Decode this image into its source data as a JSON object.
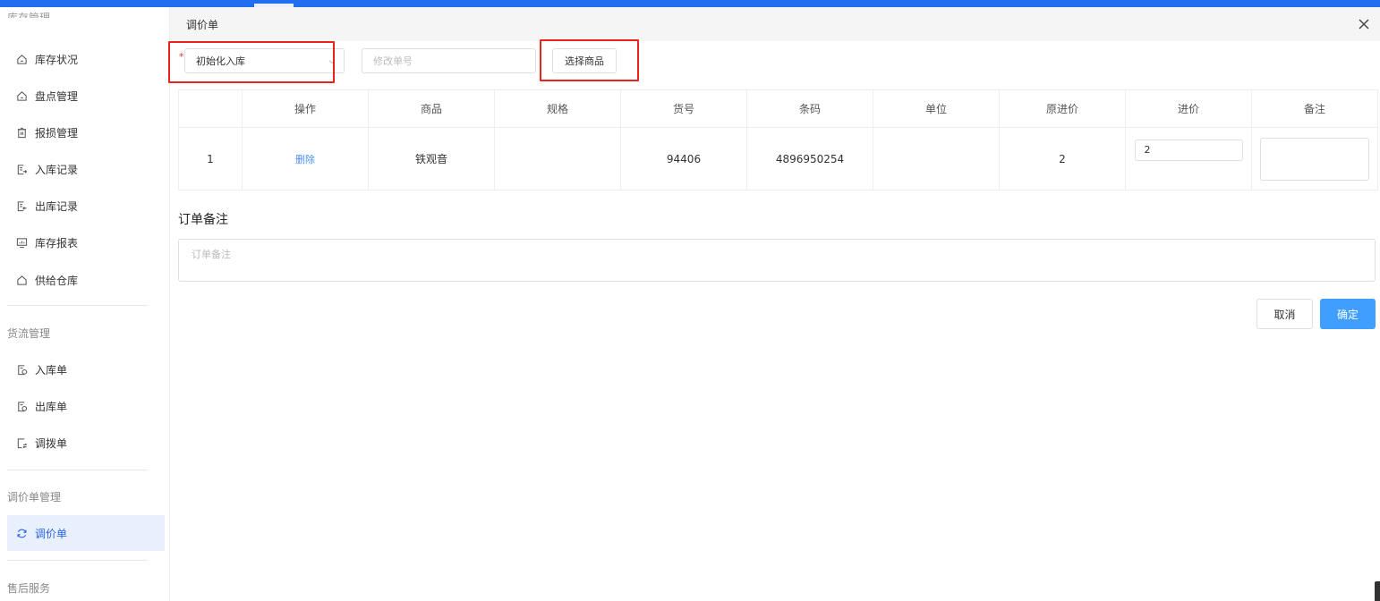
{
  "sidebar": {
    "cut_group": "库存管理",
    "items": [
      {
        "label": "库存状况",
        "icon": "home-icon"
      },
      {
        "label": "盘点管理",
        "icon": "home-icon"
      },
      {
        "label": "报损管理",
        "icon": "trash-icon"
      },
      {
        "label": "入库记录",
        "icon": "doc-in-icon"
      },
      {
        "label": "出库记录",
        "icon": "doc-out-icon"
      },
      {
        "label": "库存报表",
        "icon": "monitor-icon"
      },
      {
        "label": "供给仓库",
        "icon": "warehouse-icon"
      }
    ],
    "group2": "货流管理",
    "items2": [
      {
        "label": "入库单",
        "icon": "inbound-icon"
      },
      {
        "label": "出库单",
        "icon": "outbound-icon"
      },
      {
        "label": "调拨单",
        "icon": "transfer-icon"
      }
    ],
    "group3": "调价单管理",
    "active_item": {
      "label": "调价单",
      "icon": "refresh-icon"
    },
    "group4": "售后服务"
  },
  "dialog": {
    "title": "调价单",
    "required_mark": "*",
    "type_select": {
      "value": "初始化入库"
    },
    "order_input": {
      "placeholder": "修改单号",
      "value": ""
    },
    "choose_button": "选择商品",
    "table": {
      "headers": [
        "",
        "操作",
        "商品",
        "规格",
        "货号",
        "条码",
        "单位",
        "原进价",
        "进价",
        "备注"
      ],
      "rows": [
        {
          "index": "1",
          "action": "删除",
          "product": "铁观音",
          "spec": "",
          "item_no": "94406",
          "barcode": "4896950254",
          "unit": "",
          "orig_price": "2",
          "price": "2",
          "note": ""
        }
      ]
    },
    "remark_title": "订单备注",
    "remark_placeholder": "订单备注",
    "cancel_button": "取消",
    "confirm_button": "确定"
  },
  "colors": {
    "topbar": "#1f6ff0",
    "highlight": "#e8251d",
    "primary": "#409eff",
    "link": "#4a8ff5",
    "active_bg": "#e8effd"
  }
}
